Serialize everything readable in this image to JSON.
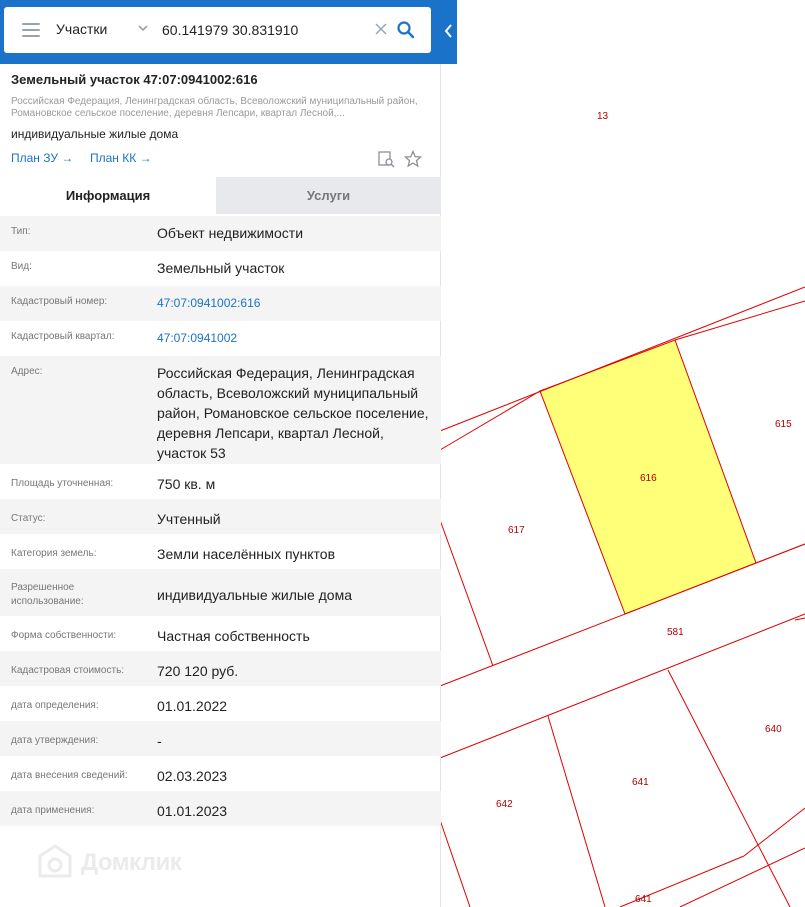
{
  "search": {
    "type_label": "Участки",
    "query": "60.141979 30.831910"
  },
  "object": {
    "title": "Земельный участок 47:07:0941002:616",
    "address": "Российская Федерация, Ленинградская область, Всеволожский муниципальный район, Романовское сельское поселение, деревня Лепсари, квартал Лесной,...",
    "usage": "индивидуальные жилые дома",
    "plan_zu": "План ЗУ →",
    "plan_kk": "План КК →"
  },
  "tabs": [
    "Информация",
    "Услуги"
  ],
  "info_rows": [
    {
      "label": "Тип:",
      "value": "Объект недвижимости"
    },
    {
      "label": "Вид:",
      "value": "Земельный участок"
    },
    {
      "label": "Кадастровый номер:",
      "value": "47:07:0941002:616"
    },
    {
      "label": "Кадастровый квартал:",
      "value": "47:07:0941002"
    },
    {
      "label": "Адрес:",
      "value": "Российская Федерация, Ленинградская область, Всеволожский муниципальный район, Романовское сельское поселение, деревня Лепсари, квартал Лесной, участок 53"
    },
    {
      "label": "Площадь уточненная:",
      "value": "750 кв. м"
    },
    {
      "label": "Статус:",
      "value": "Учтенный"
    },
    {
      "label": "Категория земель:",
      "value": "Земли населённых пунктов"
    },
    {
      "label": "Разрешенное использование:",
      "value": "индивидуальные жилые дома"
    },
    {
      "label": "Форма собственности:",
      "value": "Частная собственность"
    },
    {
      "label": "Кадастровая стоимость:",
      "value": "720 120 руб."
    },
    {
      "label": "дата определения:",
      "value": "01.01.2022"
    },
    {
      "label": "дата утверждения:",
      "value": "-"
    },
    {
      "label": "дата внесения сведений:",
      "value": "02.03.2023"
    },
    {
      "label": "дата применения:",
      "value": "01.01.2023"
    }
  ],
  "map": {
    "parcel_labels": [
      "13",
      "615",
      "616",
      "617",
      "581",
      "640",
      "641",
      "642",
      "641"
    ],
    "selected_parcel": "616"
  },
  "logo_text": "Домклик",
  "colors": {
    "header": "#1a73c8",
    "link": "#1a73c8",
    "parcel_border": "#e00000",
    "parcel_label": "#b00000",
    "selected_fill": "#ffff78"
  }
}
